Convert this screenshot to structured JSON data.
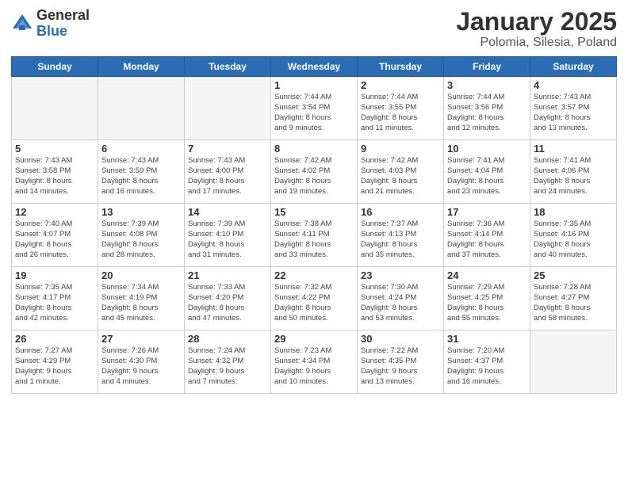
{
  "header": {
    "logo_general": "General",
    "logo_blue": "Blue",
    "title": "January 2025",
    "subtitle": "Polomia, Silesia, Poland"
  },
  "weekdays": [
    "Sunday",
    "Monday",
    "Tuesday",
    "Wednesday",
    "Thursday",
    "Friday",
    "Saturday"
  ],
  "weeks": [
    [
      {
        "day": "",
        "info": ""
      },
      {
        "day": "",
        "info": ""
      },
      {
        "day": "",
        "info": ""
      },
      {
        "day": "1",
        "info": "Sunrise: 7:44 AM\nSunset: 3:54 PM\nDaylight: 8 hours\nand 9 minutes."
      },
      {
        "day": "2",
        "info": "Sunrise: 7:44 AM\nSunset: 3:55 PM\nDaylight: 8 hours\nand 11 minutes."
      },
      {
        "day": "3",
        "info": "Sunrise: 7:44 AM\nSunset: 3:56 PM\nDaylight: 8 hours\nand 12 minutes."
      },
      {
        "day": "4",
        "info": "Sunrise: 7:43 AM\nSunset: 3:57 PM\nDaylight: 8 hours\nand 13 minutes."
      }
    ],
    [
      {
        "day": "5",
        "info": "Sunrise: 7:43 AM\nSunset: 3:58 PM\nDaylight: 8 hours\nand 14 minutes."
      },
      {
        "day": "6",
        "info": "Sunrise: 7:43 AM\nSunset: 3:59 PM\nDaylight: 8 hours\nand 16 minutes."
      },
      {
        "day": "7",
        "info": "Sunrise: 7:43 AM\nSunset: 4:00 PM\nDaylight: 8 hours\nand 17 minutes."
      },
      {
        "day": "8",
        "info": "Sunrise: 7:42 AM\nSunset: 4:02 PM\nDaylight: 8 hours\nand 19 minutes."
      },
      {
        "day": "9",
        "info": "Sunrise: 7:42 AM\nSunset: 4:03 PM\nDaylight: 8 hours\nand 21 minutes."
      },
      {
        "day": "10",
        "info": "Sunrise: 7:41 AM\nSunset: 4:04 PM\nDaylight: 8 hours\nand 23 minutes."
      },
      {
        "day": "11",
        "info": "Sunrise: 7:41 AM\nSunset: 4:06 PM\nDaylight: 8 hours\nand 24 minutes."
      }
    ],
    [
      {
        "day": "12",
        "info": "Sunrise: 7:40 AM\nSunset: 4:07 PM\nDaylight: 8 hours\nand 26 minutes."
      },
      {
        "day": "13",
        "info": "Sunrise: 7:39 AM\nSunset: 4:08 PM\nDaylight: 8 hours\nand 28 minutes."
      },
      {
        "day": "14",
        "info": "Sunrise: 7:39 AM\nSunset: 4:10 PM\nDaylight: 8 hours\nand 31 minutes."
      },
      {
        "day": "15",
        "info": "Sunrise: 7:38 AM\nSunset: 4:11 PM\nDaylight: 8 hours\nand 33 minutes."
      },
      {
        "day": "16",
        "info": "Sunrise: 7:37 AM\nSunset: 4:13 PM\nDaylight: 8 hours\nand 35 minutes."
      },
      {
        "day": "17",
        "info": "Sunrise: 7:36 AM\nSunset: 4:14 PM\nDaylight: 8 hours\nand 37 minutes."
      },
      {
        "day": "18",
        "info": "Sunrise: 7:35 AM\nSunset: 4:16 PM\nDaylight: 8 hours\nand 40 minutes."
      }
    ],
    [
      {
        "day": "19",
        "info": "Sunrise: 7:35 AM\nSunset: 4:17 PM\nDaylight: 8 hours\nand 42 minutes."
      },
      {
        "day": "20",
        "info": "Sunrise: 7:34 AM\nSunset: 4:19 PM\nDaylight: 8 hours\nand 45 minutes."
      },
      {
        "day": "21",
        "info": "Sunrise: 7:33 AM\nSunset: 4:20 PM\nDaylight: 8 hours\nand 47 minutes."
      },
      {
        "day": "22",
        "info": "Sunrise: 7:32 AM\nSunset: 4:22 PM\nDaylight: 8 hours\nand 50 minutes."
      },
      {
        "day": "23",
        "info": "Sunrise: 7:30 AM\nSunset: 4:24 PM\nDaylight: 8 hours\nand 53 minutes."
      },
      {
        "day": "24",
        "info": "Sunrise: 7:29 AM\nSunset: 4:25 PM\nDaylight: 8 hours\nand 55 minutes."
      },
      {
        "day": "25",
        "info": "Sunrise: 7:28 AM\nSunset: 4:27 PM\nDaylight: 8 hours\nand 58 minutes."
      }
    ],
    [
      {
        "day": "26",
        "info": "Sunrise: 7:27 AM\nSunset: 4:29 PM\nDaylight: 9 hours\nand 1 minute."
      },
      {
        "day": "27",
        "info": "Sunrise: 7:26 AM\nSunset: 4:30 PM\nDaylight: 9 hours\nand 4 minutes."
      },
      {
        "day": "28",
        "info": "Sunrise: 7:24 AM\nSunset: 4:32 PM\nDaylight: 9 hours\nand 7 minutes."
      },
      {
        "day": "29",
        "info": "Sunrise: 7:23 AM\nSunset: 4:34 PM\nDaylight: 9 hours\nand 10 minutes."
      },
      {
        "day": "30",
        "info": "Sunrise: 7:22 AM\nSunset: 4:35 PM\nDaylight: 9 hours\nand 13 minutes."
      },
      {
        "day": "31",
        "info": "Sunrise: 7:20 AM\nSunset: 4:37 PM\nDaylight: 9 hours\nand 16 minutes."
      },
      {
        "day": "",
        "info": ""
      }
    ]
  ]
}
